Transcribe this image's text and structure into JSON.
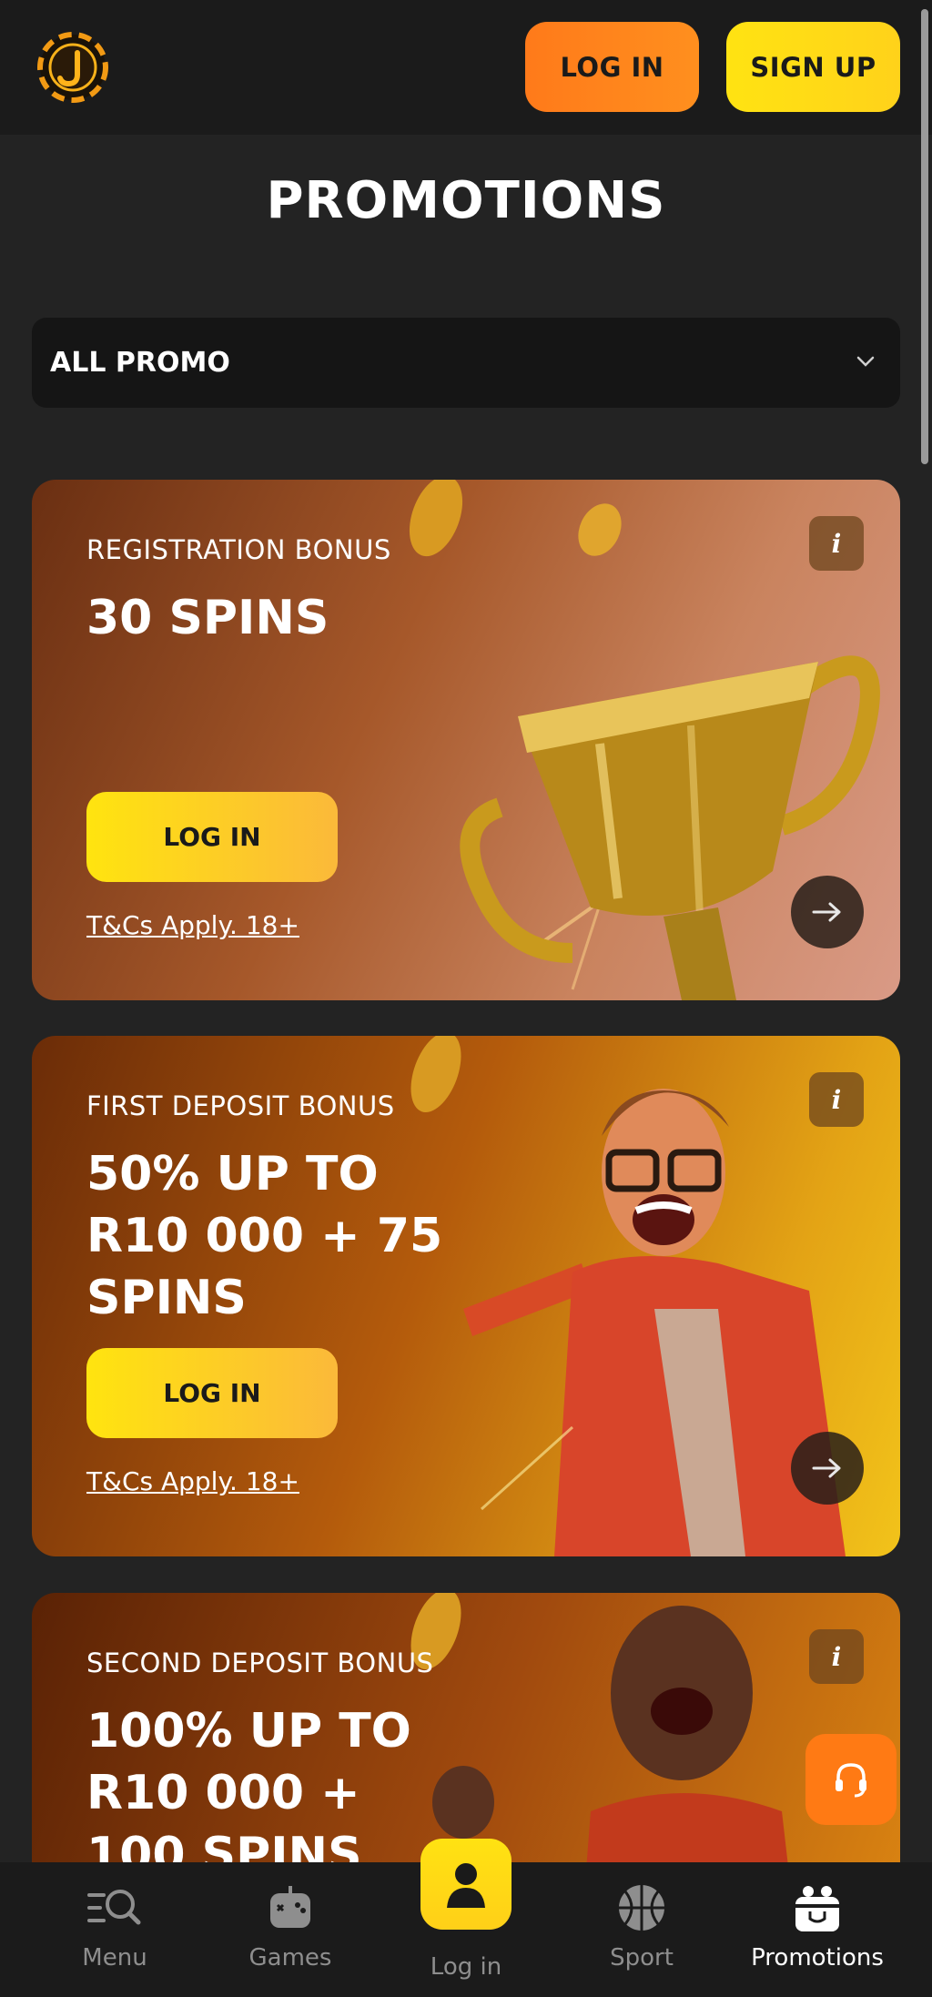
{
  "header": {
    "login_label": "LOG IN",
    "signup_label": "SIGN UP"
  },
  "page_title": "PROMOTIONS",
  "filter": {
    "selected": "ALL PROMO"
  },
  "promos": [
    {
      "kicker": "REGISTRATION BONUS",
      "title": "30 SPINS",
      "button_label": "LOG IN",
      "terms": "T&Cs Apply. 18+"
    },
    {
      "kicker": "FIRST DEPOSIT BONUS",
      "title": "50% UP TO R10 000 + 75 SPINS",
      "button_label": "LOG IN",
      "terms": "T&Cs Apply. 18+"
    },
    {
      "kicker": "SECOND DEPOSIT BONUS",
      "title": "100% UP TO R10 000 + 100 SPINS"
    }
  ],
  "bottom_nav": {
    "menu": "Menu",
    "games": "Games",
    "login": "Log in",
    "sport": "Sport",
    "promotions": "Promotions"
  },
  "colors": {
    "background": "#232323",
    "header": "#1b1b1b",
    "accent_orange": "#ff7a1a",
    "accent_yellow": "#ffe312"
  },
  "icons": [
    "logo-chip-icon",
    "chevron-down-icon",
    "info-icon",
    "arrow-right-icon",
    "headset-icon",
    "menu-search-icon",
    "gamepad-icon",
    "user-icon",
    "basketball-icon",
    "gift-icon"
  ]
}
